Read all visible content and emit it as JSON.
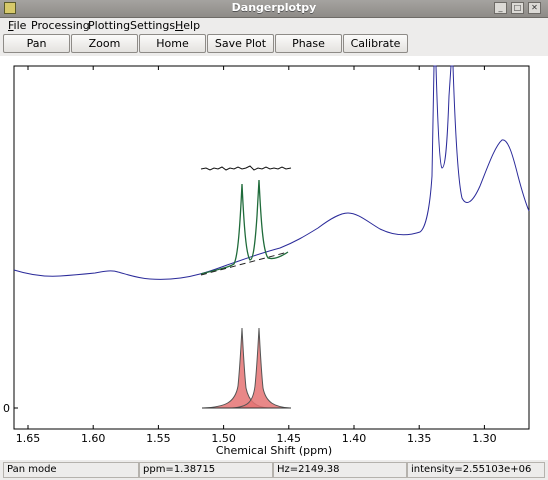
{
  "window": {
    "title": "Dangerplotpy"
  },
  "menu": {
    "items": [
      {
        "label": "File",
        "underline": "F",
        "rest": "ile"
      },
      {
        "label": "Processing",
        "underline": "",
        "rest": "Processing"
      },
      {
        "label": "Plotting",
        "underline": "",
        "rest": "Plotting"
      },
      {
        "label": "Settings",
        "underline": "",
        "rest": "Settings"
      },
      {
        "label": "Help",
        "underline": "H",
        "rest": "elp"
      }
    ]
  },
  "toolbar": {
    "pan": "Pan",
    "zoom": "Zoom",
    "home": "Home",
    "save_plot": "Save Plot",
    "phase": "Phase",
    "calibrate": "Calibrate"
  },
  "plot": {
    "xlabel": "Chemical Shift (ppm)",
    "x_ticks": [
      "1.65",
      "1.60",
      "1.55",
      "1.50",
      "1.45",
      "1.40",
      "1.35",
      "1.30"
    ],
    "y_tick_label": "0",
    "colors": {
      "spectrum": "#2b2b9a",
      "fit": "#1f6b3a",
      "residual": "#111111",
      "baseline": "#222222",
      "peaks_fill": "#e57373",
      "peaks_line": "#555555"
    }
  },
  "status": {
    "mode": "Pan mode",
    "ppm": "ppm=1.38715",
    "hz": "Hz=2149.38",
    "intensity": "intensity=2.55103e+06"
  }
}
